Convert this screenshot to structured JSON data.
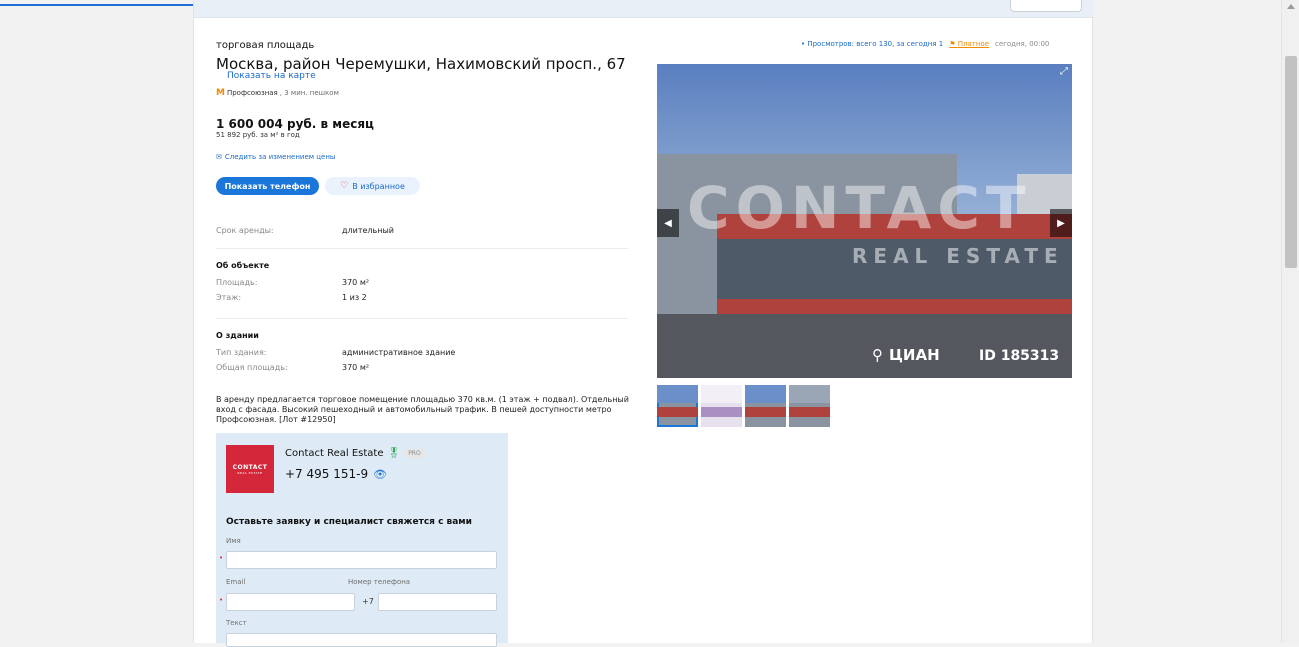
{
  "listing": {
    "type": "торговая площадь",
    "address": "Москва, район Черемушки, Нахимовский просп., 67",
    "map_link": "Показать на карте",
    "metro_name": "Профсоюзная",
    "metro_distance": ", 3 мин. пешком",
    "price": "1 600 004 руб. в месяц",
    "price_per_sqm": "51 892 руб. за м² в год",
    "watch_price": "Следить за изменением цены",
    "show_phone_button": "Показать телефон",
    "favorite_button": "В избранное"
  },
  "stats": {
    "views": "• Просмотров: всего 130, за сегодня 1",
    "paid": "Платное",
    "date": "сегодня, 00:00"
  },
  "details": {
    "lease_label": "Срок аренды:",
    "lease_value": "длительный",
    "object_heading": "Об объекте",
    "area_label": "Площадь:",
    "area_value": "370 м²",
    "floor_label": "Этаж:",
    "floor_value": "1 из 2",
    "building_heading": "О здании",
    "building_type_label": "Тип здания:",
    "building_type_value": "административное здание",
    "total_area_label": "Общая площадь:",
    "total_area_value": "370 м²"
  },
  "description": "В аренду предлагается торговое помещение площадью 370 кв.м. (1 этаж + подвал). Отдельный вход с фасада. Высокий пешеходный и автомобильный трафик. В пешей доступности метро Профсоюзная. [Лот #12950]",
  "agent": {
    "logo_text": "CONTACT",
    "logo_sub": "REAL ESTATE",
    "name": "Contact Real Estate",
    "badge": "PRO",
    "phone": "+7 495 151-9",
    "form_title": "Оставьте заявку и специалист свяжется с вами",
    "name_label": "Имя",
    "email_label": "Email",
    "phone_label": "Номер телефона",
    "phone_prefix": "+7",
    "text_label": "Текст"
  },
  "photo": {
    "watermark": "CONTACT",
    "watermark_sub": "REAL ESTATE",
    "brand": "ЦИАН",
    "id": "ID 185313"
  },
  "icons": {
    "metro": "metro-m-icon",
    "mail": "envelope-icon",
    "heart": "heart-icon",
    "eye": "eye-icon",
    "award": "award-icon",
    "paid": "paid-flag-icon"
  },
  "colors": {
    "accent": "#1a76d8",
    "metro": "#f18a00",
    "agent_panel": "#deebf7",
    "logo": "#d4283a"
  }
}
